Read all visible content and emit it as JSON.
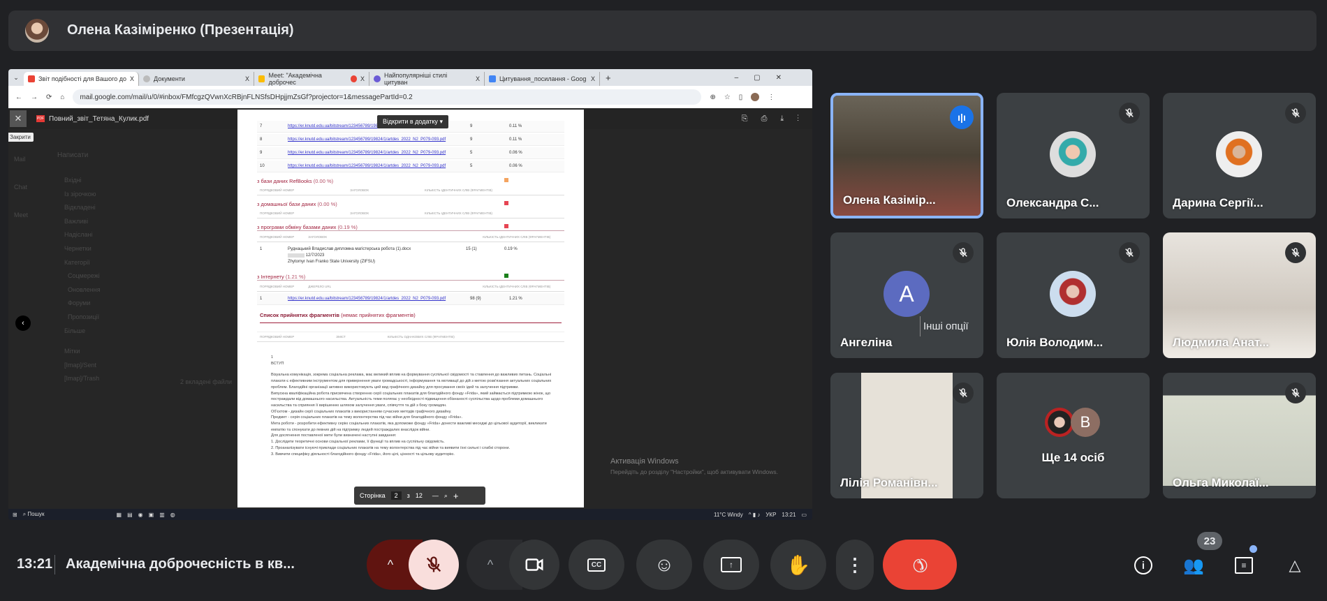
{
  "header": {
    "presenter": "Олена Казіміренко (Презентація)"
  },
  "browser": {
    "tabs": [
      {
        "label": "Звіт подібності для Вашого до",
        "color": "#ea4335"
      },
      {
        "label": "Документи",
        "color": "#bbbbbb"
      },
      {
        "label": "Meet: \"Академічна доброчес",
        "color": "#fbbc04"
      },
      {
        "label": "Найпопулярніші стилі цитуван",
        "color": "#6b5bd6"
      },
      {
        "label": "Цитування_посилання - Goog",
        "color": "#4285f4"
      }
    ],
    "new_tab": "+",
    "close": "X",
    "url": "mail.google.com/mail/u/0/#inbox/FMfcgzQVwnXcRBjnFLNSfsDHpjjmZsGf?projector=1&messagePartId=0.2",
    "pdf_filename": "Повний_звіт_Тетяна_Кулик.pdf",
    "close_tooltip": "Закрити",
    "open_in_app": "Відкрити в додатку",
    "pdf_badge": "PDF"
  },
  "gmail_bg": {
    "compose": "Написати",
    "items": [
      "Вхідні",
      "Із зірочкою",
      "Відкладені",
      "Важливі",
      "Надіслані",
      "Чернетки",
      "Категорії",
      "Соцмережі",
      "Оновлення",
      "Форуми",
      "Пропозиції",
      "Більше"
    ],
    "labels_header": "Мітки",
    "labels": [
      "[Imap]/Sent",
      "[Imap]/Trash"
    ],
    "attachments": "2 вкладені файли",
    "rail": [
      "Mail",
      "Chat",
      "Meet"
    ]
  },
  "pdf": {
    "rows": [
      {
        "n": "7",
        "url": "https://er.knutd.edu.ua/bitstream/123456789/19824/1/artdes_2022_N2_P079-093.pdf",
        "count": "9",
        "pct": "0.11 %"
      },
      {
        "n": "8",
        "url": "https://er.knutd.edu.ua/bitstream/123456789/19824/1/artdes_2022_N2_P079-093.pdf",
        "count": "9",
        "pct": "0.11 %"
      },
      {
        "n": "9",
        "url": "https://er.knutd.edu.ua/bitstream/123456789/19824/1/artdes_2022_N2_P079-093.pdf",
        "count": "5",
        "pct": "0.06 %"
      },
      {
        "n": "10",
        "url": "https://er.knutd.edu.ua/bitstream/123456789/19824/1/artdes_2022_N2_P079-093.pdf",
        "count": "5",
        "pct": "0.06 %"
      }
    ],
    "sections": [
      {
        "title": "з бази даних RefBooks",
        "pct": "(0.00 %)",
        "color": "#f4a460"
      },
      {
        "title": "з домашньої бази даних",
        "pct": "(0.00 %)",
        "color": "#e64553"
      },
      {
        "title": "з програми обміну базами даних",
        "pct": "(0.19 %)",
        "color": "#e64553"
      },
      {
        "title": "з Інтернету",
        "pct": "(1.21 %)",
        "color": "#1a7f1a"
      }
    ],
    "col_headers": {
      "num": "ПОРЯДКОВИЙ НОМЕР",
      "title": "ЗАГОЛОВОК",
      "count": "КІЛЬКІСТЬ ІДЕНТИЧНИХ СЛІВ (ФРАГМЕНТІВ)",
      "source": "ДЖЕРЕЛО URL",
      "content": "ЗМІСТ",
      "same": "КІЛЬКІСТЬ ОДНАКОВИХ СЛІВ (ФРАГМЕНТІВ)"
    },
    "exchange_row": {
      "n": "1",
      "title": "Руднацький Владислав дипломна магістерська робота (1).docx",
      "date": "12/7/2023",
      "org": "Zhytomyr Ivan Franko State University (ZIFSU)",
      "count": "15 (1)",
      "pct": "0.19 %"
    },
    "internet_row": {
      "n": "1",
      "url": "https://er.knutd.edu.ua/bitstream/123456789/19824/1/artdes_2022_N2_P079-093.pdf",
      "count": "98 (9)",
      "pct": "1.21 %"
    },
    "accepted_title": "Список прийнятих фрагментів",
    "accepted_note": "(немає прийнятих фрагментів)",
    "page_num": "1",
    "heading": "ВСТУП",
    "paragraphs": [
      "Візуальна комунікація, зокрема соціальна реклама, має великий вплив на формування суспільної свідомості та ставлення до важливих питань. Соціальні плакати є ефективним інструментом для привернення уваги громадськості, інформування та мотивації до дій з метою розв'язання актуальних соціальних проблем. Благодійні організації активно використовують цей вид графічного дизайну для просування своїх ідей та залучення підтримки.",
      "Випускна кваліфікаційна робота присвячена створенню серії соціальних плакатів для благодійного фонду «Frida», який займається підтримкою жінок, що постраждали від домашнього насильства. Актуальність теми полягає у необхідності підвищення обізнаності суспільства щодо проблеми домашнього насильства та сприяння її вирішенню шляхом залучення уваги, співчуття та дій з боку громадян.",
      "Об'єктом - дизайн серії соціальних плакатів з використанням сучасних методів графічного дизайну.",
      "Предмет - серія соціальних плакатів на тему волонтерства під час війни для благодійного фонду «Frida».",
      "Мета роботи - розробити ефективну серію соціальних плакатів, яка допоможе фонду «Frida» донести важливі меседжі до цільової аудиторії, викликати емпатію та спонукати до певних дій на підтримку людей постраждалих внаслідок війни.",
      "Для досягнення поставленої мети були визначені наступні завдання:",
      "1. Дослідити теоретичні основи соціальної реклами, її функції та вплив на суспільну свідомість.",
      "2. Проаналізувати існуючі приклади соціальних плакатів на тему волонтерства під час війни та виявити їхні сильні і слабкі сторони.",
      "3. Вивчити специфіку діяльності благодійного фонду «Frida», його цілі, цінності та цільову аудиторію."
    ],
    "page_ctl": {
      "label": "Сторінка",
      "current": "2",
      "of": "з",
      "total": "12",
      "minus": "—",
      "plus": "+"
    }
  },
  "windows": {
    "activation_title": "Активація Windows",
    "activation_text": "Перейдіть до розділу \"Настройки\", щоб активувати Windows.",
    "search": "Пошук",
    "weather": "11°C Windy",
    "lang": "УКР",
    "time": "13:21"
  },
  "participants": [
    {
      "name": "Олена Казімір...",
      "type": "video",
      "speaking": true
    },
    {
      "name": "Олександра С...",
      "type": "photo",
      "muted": true
    },
    {
      "name": "Дарина Сергії...",
      "type": "photo",
      "muted": true
    },
    {
      "name": "Ангеліна",
      "type": "letter",
      "letter": "А",
      "color": "#5c6bc0",
      "muted": true,
      "tooltip": "Інші опції"
    },
    {
      "name": "Юлія Володим...",
      "type": "photo",
      "muted": true
    },
    {
      "name": "Людмила Анат...",
      "type": "video",
      "muted": true
    },
    {
      "name": "Лілія Романівн...",
      "type": "video",
      "muted": true
    },
    {
      "name": "Ще 14 осіб",
      "type": "group",
      "letter": "В",
      "color": "#8d6e63"
    },
    {
      "name": "Ольга Миколаї...",
      "type": "video",
      "muted": true
    }
  ],
  "bottom": {
    "time": "13:21",
    "meeting_title": "Академічна доброчесність в кв...",
    "participants_count": "23"
  },
  "colors": {
    "end_call": "#ea4335",
    "mic_muted_bg": "#f9dedc",
    "mic_arrow_bg": "#601410",
    "speaking": "#1a73e8"
  }
}
